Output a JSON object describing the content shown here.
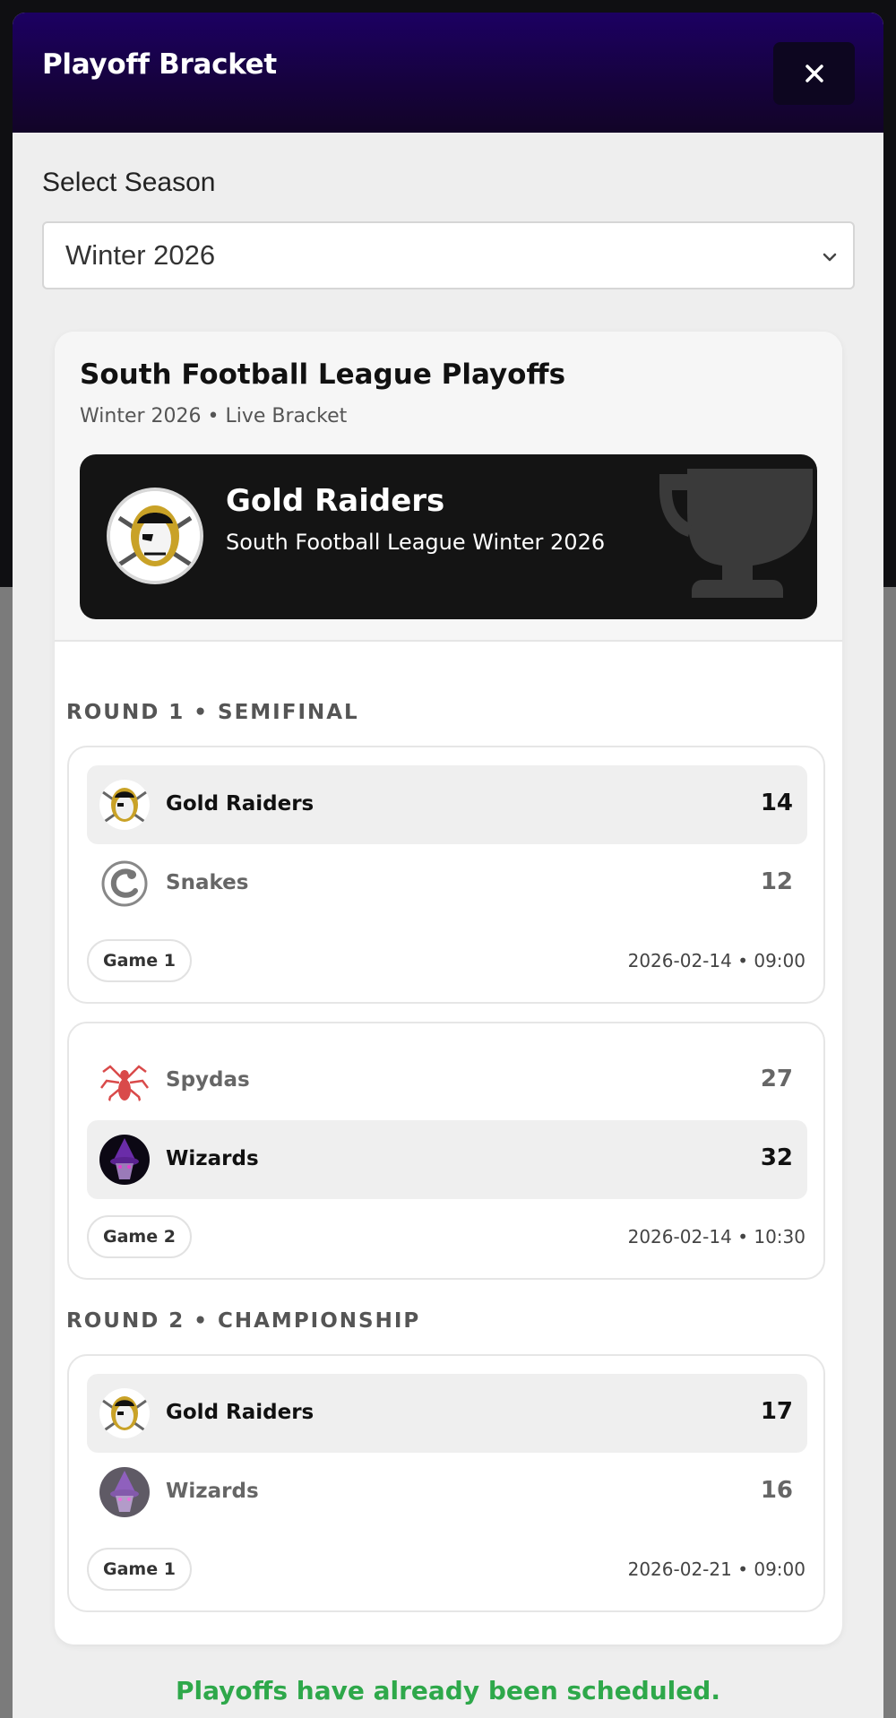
{
  "modal": {
    "title": "Playoff Bracket",
    "close_icon": "close-icon"
  },
  "season": {
    "label": "Select Season",
    "selected": "Winter 2026"
  },
  "bracket": {
    "title": "South Football League Playoffs",
    "subtitle": "Winter 2026 • Live Bracket",
    "champion": {
      "name": "Gold Raiders",
      "subtitle": "South Football League Winter 2026"
    },
    "rounds": [
      {
        "label": "ROUND 1 • SEMIFINAL",
        "matches": [
          {
            "teams": [
              {
                "name": "Gold Raiders",
                "score": "14",
                "winner": true,
                "logo": "raider-logo"
              },
              {
                "name": "Snakes",
                "score": "12",
                "winner": false,
                "logo": "snake-logo"
              }
            ],
            "game": "Game 1",
            "time": "2026-02-14 • 09:00"
          },
          {
            "teams": [
              {
                "name": "Spydas",
                "score": "27",
                "winner": false,
                "logo": "spider-logo"
              },
              {
                "name": "Wizards",
                "score": "32",
                "winner": true,
                "logo": "wizard-logo"
              }
            ],
            "game": "Game 2",
            "time": "2026-02-14 • 10:30"
          }
        ]
      },
      {
        "label": "ROUND 2 • CHAMPIONSHIP",
        "matches": [
          {
            "teams": [
              {
                "name": "Gold Raiders",
                "score": "17",
                "winner": true,
                "logo": "raider-logo"
              },
              {
                "name": "Wizards",
                "score": "16",
                "winner": false,
                "logo": "wizard-logo"
              }
            ],
            "game": "Game 1",
            "time": "2026-02-21 • 09:00"
          }
        ]
      }
    ]
  },
  "status_message": "Playoffs have already been scheduled.",
  "colors": {
    "header": "#1c0062",
    "success": "#2ea84a",
    "banner": "#141414"
  }
}
